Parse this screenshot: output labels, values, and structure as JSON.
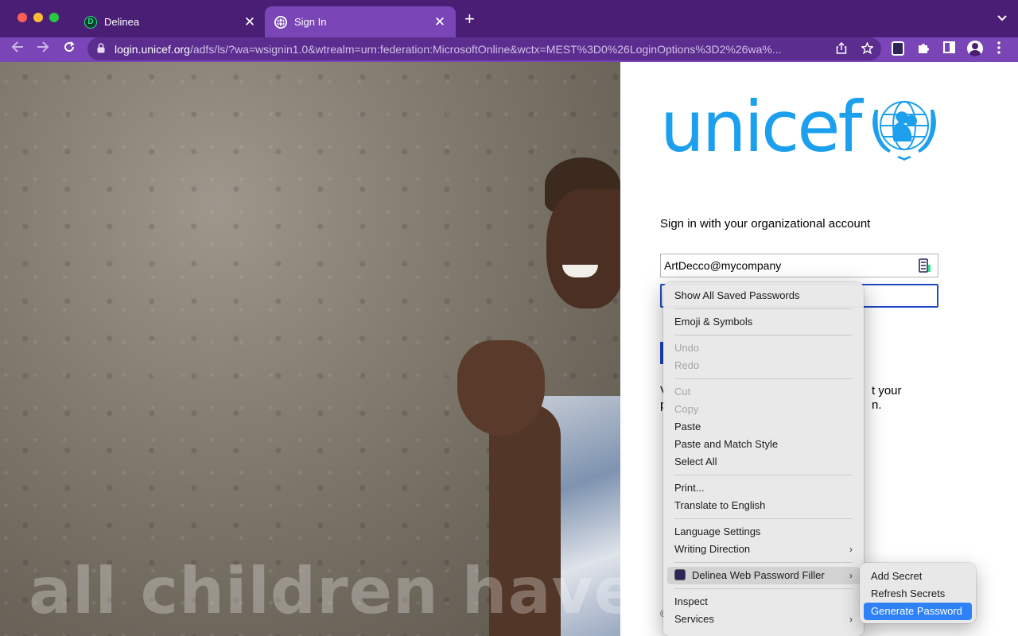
{
  "browser": {
    "tabs": [
      {
        "title": "Delinea",
        "favicon": "delinea-d-icon",
        "active": false
      },
      {
        "title": "Sign In",
        "favicon": "globe-icon",
        "active": true
      }
    ],
    "close_glyph": "✕",
    "new_tab_glyph": "+",
    "url_host": "login.unicef.org",
    "url_rest": "/adfs/ls/?wa=wsignin1.0&wtrealm=urn:federation:MicrosoftOnline&wctx=MEST%3D0%26LoginOptions%3D2%26wa%...",
    "colors": {
      "tabbar": "#4a1e75",
      "toolbar": "#7a45b6"
    }
  },
  "hero": {
    "slogan": "all children have rig"
  },
  "login": {
    "logo_text": "unicef",
    "brand_color": "#1ca0ed",
    "title": "Sign in with your organizational account",
    "username_value": "ArtDecco@mycompany",
    "password_value": "",
    "help_left_1": "V",
    "help_left_2": "p",
    "help_right_1": "t your",
    "help_right_2": "n.",
    "footer_left": "©"
  },
  "context_menu": {
    "show_all_saved_passwords": "Show All Saved Passwords",
    "emoji_symbols": "Emoji & Symbols",
    "undo": "Undo",
    "redo": "Redo",
    "cut": "Cut",
    "copy": "Copy",
    "paste": "Paste",
    "paste_match_style": "Paste and Match Style",
    "select_all": "Select All",
    "print": "Print...",
    "translate": "Translate to English",
    "language_settings": "Language Settings",
    "writing_direction": "Writing Direction",
    "delinea_filler": "Delinea Web Password Filler",
    "inspect": "Inspect",
    "services": "Services",
    "arrow": "›"
  },
  "submenu": {
    "add_secret": "Add Secret",
    "refresh_secrets": "Refresh Secrets",
    "generate_password": "Generate Password",
    "selected_color": "#2f81f7"
  }
}
